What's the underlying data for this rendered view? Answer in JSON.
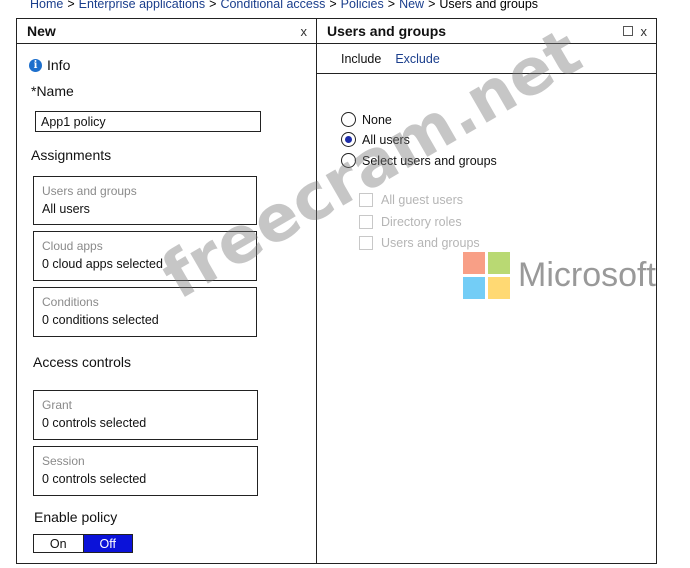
{
  "breadcrumb": [
    {
      "label": "Home",
      "link": true
    },
    {
      "label": "Enterprise applications",
      "link": true
    },
    {
      "label": "Conditional access",
      "link": true
    },
    {
      "label": "Policies",
      "link": true
    },
    {
      "label": "New",
      "link": true
    },
    {
      "label": "Users and groups",
      "link": false
    }
  ],
  "breadcrumb_separator": ">",
  "left_blade": {
    "title": "New",
    "close": "x",
    "info_label": "Info",
    "info_icon": "info-icon",
    "name_label": "*Name",
    "name_value": "App1 policy",
    "assignments_title": "Assignments",
    "cards": [
      {
        "title": "Users and groups",
        "value": "All users"
      },
      {
        "title": "Cloud apps",
        "value": "0 cloud apps selected"
      },
      {
        "title": "Conditions",
        "value": "0 conditions selected"
      }
    ],
    "access_controls_title": "Access controls",
    "access_cards": [
      {
        "title": "Grant",
        "value": "0 controls selected"
      },
      {
        "title": "Session",
        "value": "0 controls selected"
      }
    ],
    "enable_policy_label": "Enable policy",
    "toggle": {
      "on": "On",
      "off": "Off",
      "selected": "Off"
    }
  },
  "right_blade": {
    "title": "Users and groups",
    "close": "x",
    "tabs": [
      {
        "label": "Include",
        "active": true
      },
      {
        "label": "Exclude",
        "active": false
      }
    ],
    "radios": [
      {
        "label": "None",
        "checked": false
      },
      {
        "label": "All users",
        "checked": true
      },
      {
        "label": "Select users and groups",
        "checked": false
      }
    ],
    "checkboxes": [
      {
        "label": "All guest users",
        "checked": false,
        "disabled": true
      },
      {
        "label": "Directory roles",
        "checked": false,
        "disabled": true
      },
      {
        "label": "Users and groups",
        "checked": false,
        "disabled": true
      }
    ]
  },
  "watermark": "freecram.net",
  "logo": {
    "text": "Microsoft",
    "colors": [
      "#f25022",
      "#7fba00",
      "#00a4ef",
      "#ffb900"
    ]
  },
  "colors": {
    "link": "#1a3e8c",
    "toggle_active": "#0b12d9",
    "info": "#1d6fcc"
  }
}
